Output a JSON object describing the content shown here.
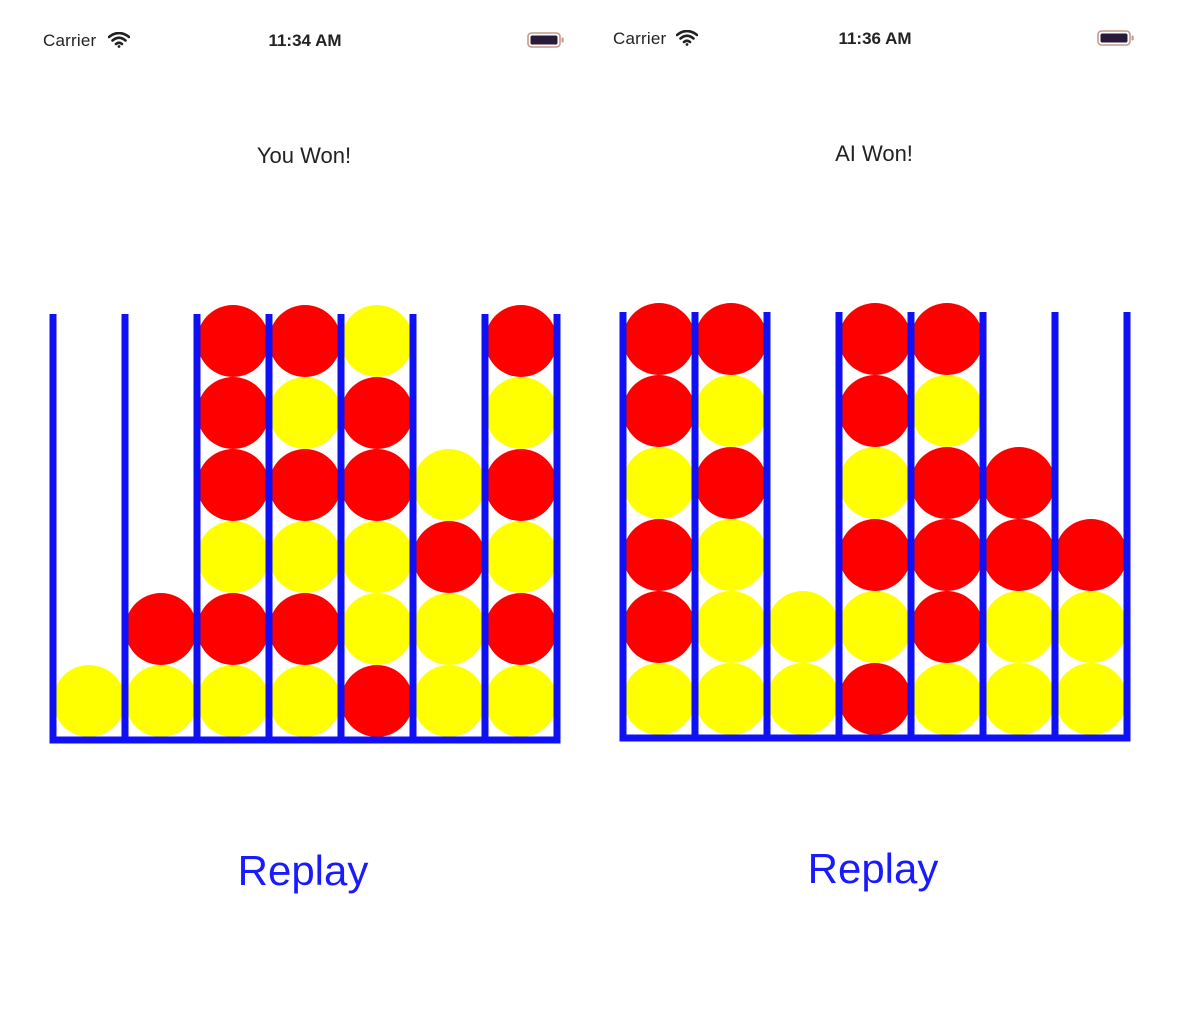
{
  "colors": {
    "frame": "#1010f5",
    "red": "#ff0000",
    "yellow": "#ffff00",
    "link": "#1a1aff"
  },
  "screens": [
    {
      "status": {
        "carrier": "Carrier",
        "time": "11:34 AM"
      },
      "result_text": "You Won!",
      "replay_label": "Replay",
      "board": {
        "columns": 7,
        "rows": 6,
        "cells": [
          [
            null,
            null,
            "R",
            "R",
            "Y",
            null,
            "R"
          ],
          [
            null,
            null,
            "R",
            "Y",
            "R",
            null,
            "Y"
          ],
          [
            null,
            null,
            "R",
            "R",
            "R",
            "Y",
            "R"
          ],
          [
            null,
            null,
            "Y",
            "Y",
            "Y",
            "R",
            "Y"
          ],
          [
            null,
            "R",
            "R",
            "R",
            "Y",
            "Y",
            "R"
          ],
          [
            "Y",
            "Y",
            "Y",
            "Y",
            "R",
            "Y",
            "Y"
          ]
        ]
      }
    },
    {
      "status": {
        "carrier": "Carrier",
        "time": "11:36 AM"
      },
      "result_text": "AI Won!",
      "replay_label": "Replay",
      "board": {
        "columns": 7,
        "rows": 6,
        "cells": [
          [
            "R",
            "R",
            null,
            "R",
            "R",
            null,
            null
          ],
          [
            "R",
            "Y",
            null,
            "R",
            "Y",
            null,
            null
          ],
          [
            "Y",
            "R",
            null,
            "Y",
            "R",
            "R",
            null
          ],
          [
            "R",
            "Y",
            null,
            "R",
            "R",
            "R",
            "R"
          ],
          [
            "R",
            "Y",
            "Y",
            "Y",
            "R",
            "Y",
            "Y"
          ],
          [
            "Y",
            "Y",
            "Y",
            "R",
            "Y",
            "Y",
            "Y"
          ]
        ]
      }
    }
  ]
}
